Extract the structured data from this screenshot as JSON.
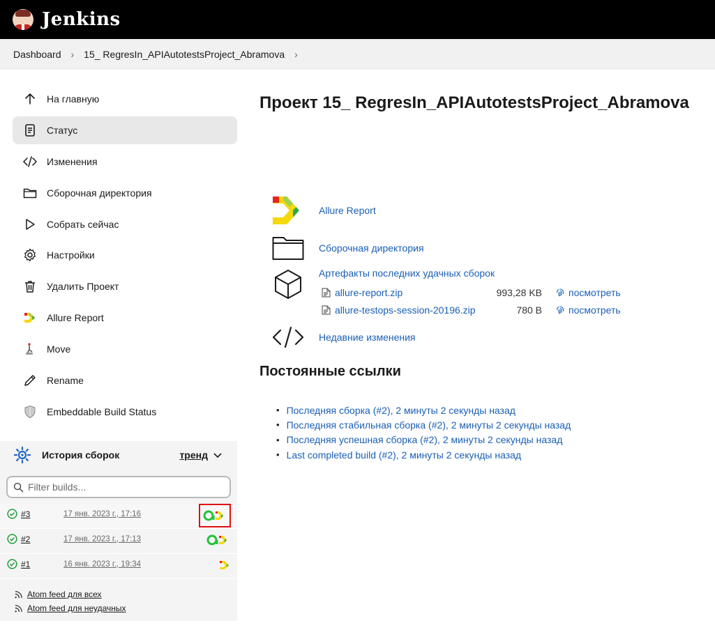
{
  "header": {
    "brand": "Jenkins"
  },
  "breadcrumb": {
    "items": [
      "Dashboard",
      "15_ RegresIn_APIAutotestsProject_Abramova"
    ]
  },
  "sidebar": {
    "items": [
      {
        "label": "На главную",
        "icon": "arrow-up-icon"
      },
      {
        "label": "Статус",
        "icon": "document-icon"
      },
      {
        "label": "Изменения",
        "icon": "code-icon"
      },
      {
        "label": "Сборочная директория",
        "icon": "folder-icon"
      },
      {
        "label": "Собрать сейчас",
        "icon": "play-icon"
      },
      {
        "label": "Настройки",
        "icon": "gear-icon"
      },
      {
        "label": "Удалить Проект",
        "icon": "trash-icon"
      },
      {
        "label": "Allure Report",
        "icon": "allure-icon"
      },
      {
        "label": "Move",
        "icon": "move-icon"
      },
      {
        "label": "Rename",
        "icon": "pencil-icon"
      },
      {
        "label": "Embeddable Build Status",
        "icon": "shield-icon"
      }
    ]
  },
  "history": {
    "title": "История сборок",
    "trend": "тренд",
    "filter_placeholder": "Filter builds...",
    "builds": [
      {
        "num": "#3",
        "date": "17 янв. 2023 г., 17:16"
      },
      {
        "num": "#2",
        "date": "17 янв. 2023 г., 17:13"
      },
      {
        "num": "#1",
        "date": "16 янв. 2023 г., 19:34"
      }
    ],
    "feeds": [
      "Atom feed для всех",
      "Atom feed для неудачных"
    ]
  },
  "main": {
    "title": "Проект 15_ RegresIn_APIAutotestsProject_Abramova",
    "links": {
      "allure": "Allure Report",
      "workspace": "Сборочная директория",
      "artifacts_title": "Артефакты последних удачных сборок",
      "changes": "Недавние изменения"
    },
    "artifacts": [
      {
        "name": "allure-report.zip",
        "size": "993,28 KB",
        "view": "посмотреть"
      },
      {
        "name": "allure-testops-session-20196.zip",
        "size": "780 B",
        "view": "посмотреть"
      }
    ],
    "permalinks_title": "Постоянные ссылки",
    "permalinks": [
      "Последняя сборка (#2), 2 минуты 2 секунды назад",
      "Последняя стабильная сборка (#2), 2 минуты 2 секунды назад",
      "Последняя успешная сборка (#2), 2 минуты 2 секунды назад",
      "Last completed build (#2), 2 минуты 2 секунды назад"
    ]
  }
}
